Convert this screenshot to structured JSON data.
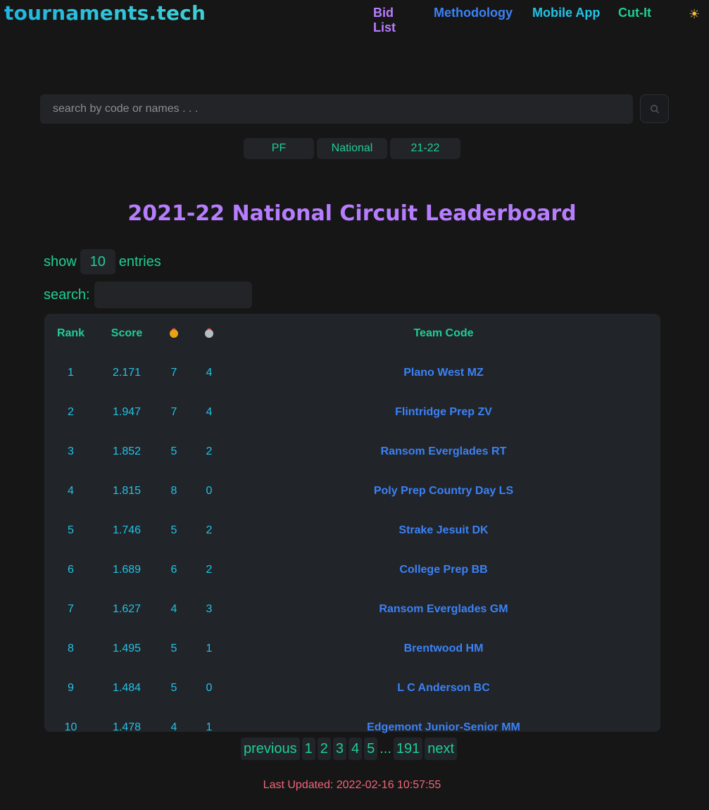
{
  "header": {
    "logo": "tournaments.tech",
    "nav": [
      "Bid List",
      "Methodology",
      "Mobile App",
      "Cut-It"
    ],
    "theme_icon": "sun-icon"
  },
  "search": {
    "placeholder": "search by code or names . . ."
  },
  "filters": [
    "PF",
    "National",
    "21-22"
  ],
  "title": "2021-22 National Circuit Leaderboard",
  "controls": {
    "show_label": "show",
    "entries_value": "10",
    "entries_label": "entries",
    "search_label": "search:"
  },
  "table": {
    "headers": [
      "Rank",
      "Score",
      "gold-medal",
      "silver-medal",
      "Team Code"
    ],
    "rows": [
      [
        "1",
        "2.171",
        "7",
        "4",
        "Plano West MZ"
      ],
      [
        "2",
        "1.947",
        "7",
        "4",
        "Flintridge Prep ZV"
      ],
      [
        "3",
        "1.852",
        "5",
        "2",
        "Ransom Everglades RT"
      ],
      [
        "4",
        "1.815",
        "8",
        "0",
        "Poly Prep Country Day LS"
      ],
      [
        "5",
        "1.746",
        "5",
        "2",
        "Strake Jesuit DK"
      ],
      [
        "6",
        "1.689",
        "6",
        "2",
        "College Prep BB"
      ],
      [
        "7",
        "1.627",
        "4",
        "3",
        "Ransom Everglades GM"
      ],
      [
        "8",
        "1.495",
        "5",
        "1",
        "Brentwood HM"
      ],
      [
        "9",
        "1.484",
        "5",
        "0",
        "L C Anderson BC"
      ],
      [
        "10",
        "1.478",
        "4",
        "1",
        "Edgemont Junior-Senior MM"
      ]
    ]
  },
  "pager": {
    "previous": "previous",
    "pages": [
      "1",
      "2",
      "3",
      "4",
      "5"
    ],
    "ellipsis": "...",
    "last": "191",
    "next": "next"
  },
  "footer": {
    "updated": "Last Updated: 2022-02-16 10:57:55"
  }
}
